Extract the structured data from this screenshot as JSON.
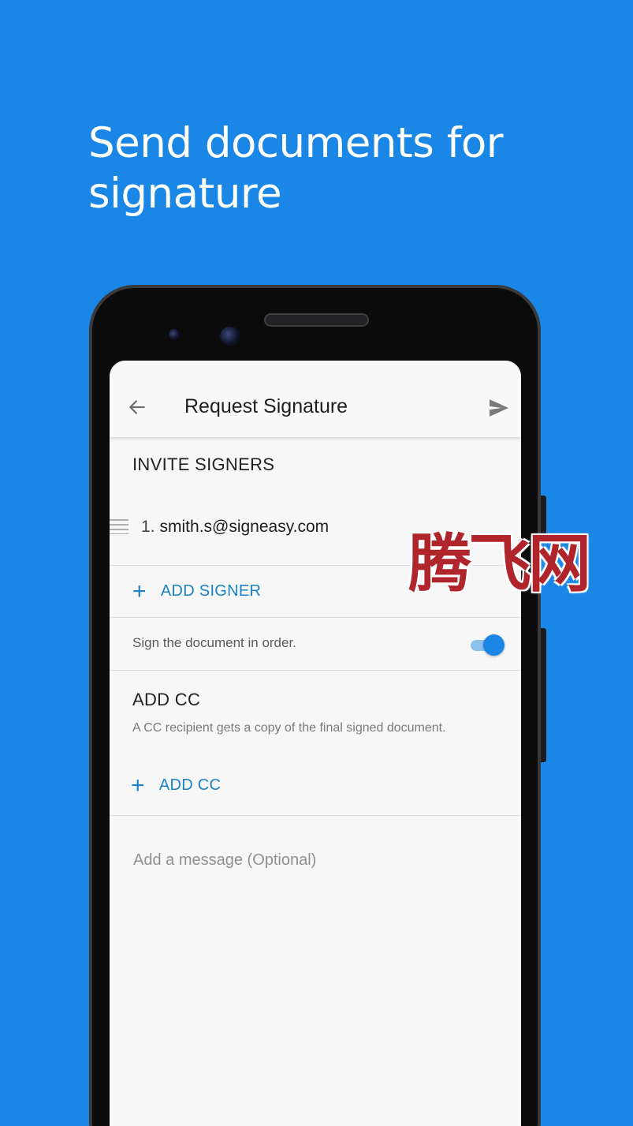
{
  "promo": {
    "headline": "Send documents for signature"
  },
  "appbar": {
    "title": "Request Signature",
    "back_icon": "arrow-left-icon",
    "send_icon": "send-icon"
  },
  "signers": {
    "heading": "INVITE SIGNERS",
    "items": [
      {
        "number": "1.",
        "email": "smith.s@signeasy.com"
      }
    ],
    "add_label": "ADD SIGNER"
  },
  "order": {
    "label": "Sign the document in order.",
    "enabled": true
  },
  "cc": {
    "heading": "ADD CC",
    "description": "A CC recipient gets a copy of the final signed document.",
    "add_label": "ADD CC"
  },
  "message": {
    "placeholder": "Add a message (Optional)",
    "value": ""
  },
  "watermark": {
    "text": "腾飞网"
  },
  "colors": {
    "background": "#1a86e6",
    "accent": "#1c82c8",
    "watermark": "#b0252b"
  }
}
